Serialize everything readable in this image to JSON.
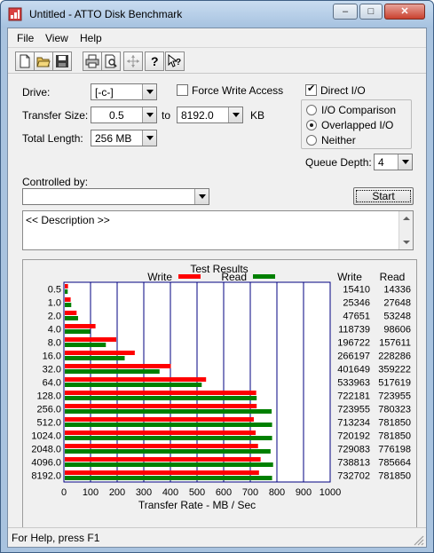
{
  "window": {
    "title": "Untitled - ATTO Disk Benchmark"
  },
  "caption_buttons": {
    "minimize": "–",
    "maximize": "□",
    "close": "✕"
  },
  "menu": [
    "File",
    "View",
    "Help"
  ],
  "toolbar": [
    "new-icon",
    "open-icon",
    "save-icon",
    "print-icon",
    "print-preview-icon",
    "move-icon",
    "help-icon",
    "context-help-icon"
  ],
  "form": {
    "drive_label": "Drive:",
    "drive_value": "[-c-]",
    "force_write_label": "Force Write Access",
    "force_write_checked": false,
    "direct_io_label": "Direct I/O",
    "direct_io_checked": true,
    "transfer_size_label": "Transfer Size:",
    "transfer_from": "0.5",
    "to_label": "to",
    "transfer_to": "8192.0",
    "kb_label": "KB",
    "total_length_label": "Total Length:",
    "total_length_value": "256 MB",
    "io_options": [
      {
        "label": "I/O Comparison",
        "selected": false
      },
      {
        "label": "Overlapped I/O",
        "selected": true
      },
      {
        "label": "Neither",
        "selected": false
      }
    ],
    "queue_depth_label": "Queue Depth:",
    "queue_depth_value": "4",
    "controlled_by_label": "Controlled by:",
    "controlled_by_value": "",
    "start_label": "Start",
    "description_text": "<< Description >>"
  },
  "results": {
    "title": "Test Results",
    "legend_write": "Write",
    "legend_read": "Read",
    "col_write": "Write",
    "col_read": "Read"
  },
  "chart_data": {
    "type": "bar",
    "orientation": "horizontal",
    "title": "Test Results",
    "xlabel": "Transfer Rate - MB / Sec",
    "ylabel": "",
    "xlim": [
      0,
      1000
    ],
    "xticks": [
      "0",
      "100",
      "200",
      "300",
      "400",
      "500",
      "600",
      "700",
      "800",
      "900",
      "1000"
    ],
    "categories": [
      "0.5",
      "1.0",
      "2.0",
      "4.0",
      "8.0",
      "16.0",
      "32.0",
      "64.0",
      "128.0",
      "256.0",
      "512.0",
      "1024.0",
      "2048.0",
      "4096.0",
      "8192.0"
    ],
    "series": [
      {
        "name": "Write",
        "color": "#ff0000",
        "values": [
          15.4,
          25.3,
          47.7,
          118.7,
          196.7,
          266.2,
          401.6,
          534.0,
          722.2,
          724.0,
          713.2,
          720.2,
          729.1,
          738.8,
          732.7
        ],
        "labels": [
          "15410",
          "25346",
          "47651",
          "118739",
          "196722",
          "266197",
          "401649",
          "533963",
          "722181",
          "723955",
          "713234",
          "720192",
          "729083",
          "738813",
          "732702"
        ]
      },
      {
        "name": "Read",
        "color": "#008000",
        "values": [
          14.3,
          27.6,
          53.2,
          98.6,
          157.6,
          228.3,
          359.2,
          517.6,
          724.0,
          780.3,
          781.9,
          781.9,
          776.2,
          785.7,
          781.9
        ],
        "labels": [
          "14336",
          "27648",
          "53248",
          "98606",
          "157611",
          "228286",
          "359222",
          "517619",
          "723955",
          "780323",
          "781850",
          "781850",
          "776198",
          "785664",
          "781850"
        ]
      }
    ],
    "grid": true,
    "legend": "top"
  },
  "status": {
    "text": "For Help, press F1"
  }
}
